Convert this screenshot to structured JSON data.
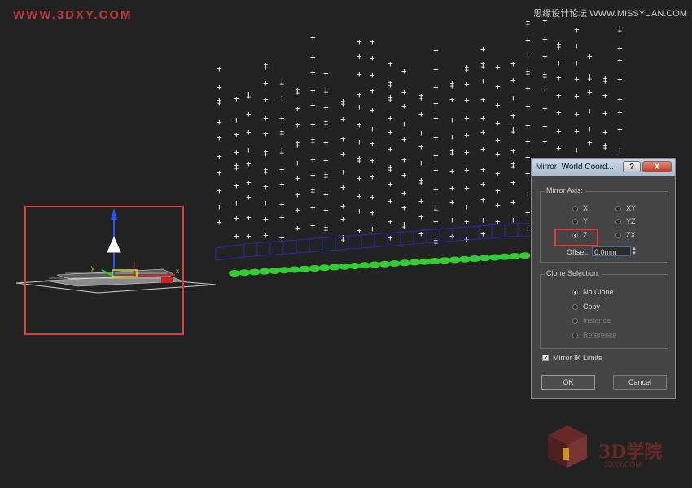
{
  "watermarks": {
    "top_left": "WWW.3DXY.COM",
    "top_right": "思缘设计论坛 WWW.MISSYUAN.COM",
    "bottom_right": "3D学院",
    "bottom_right_sub": "3DXY.COM"
  },
  "dialog": {
    "title": "Mirror: World Coord...",
    "help_label": "?",
    "close_label": "X",
    "mirror_axis": {
      "label": "Mirror Axis:",
      "options": [
        "X",
        "Y",
        "Z",
        "XY",
        "YZ",
        "ZX"
      ],
      "selected": "Z"
    },
    "offset": {
      "label": "Offset:",
      "value": "0.0mm"
    },
    "clone_selection": {
      "label": "Clone Selection:",
      "options": [
        "No Clone",
        "Copy",
        "Instance",
        "Reference"
      ],
      "selected": "No Clone"
    },
    "mirror_ik": {
      "label": "Mirror IK Limits",
      "checked": true
    },
    "ok_label": "OK",
    "cancel_label": "Cancel"
  },
  "gizmo_labels": {
    "y": "y",
    "x": "x"
  },
  "colors": {
    "background": "#222222",
    "highlight": "#e03c3c",
    "grass": "#33cc33",
    "box_wire": "#2a2aa8"
  }
}
